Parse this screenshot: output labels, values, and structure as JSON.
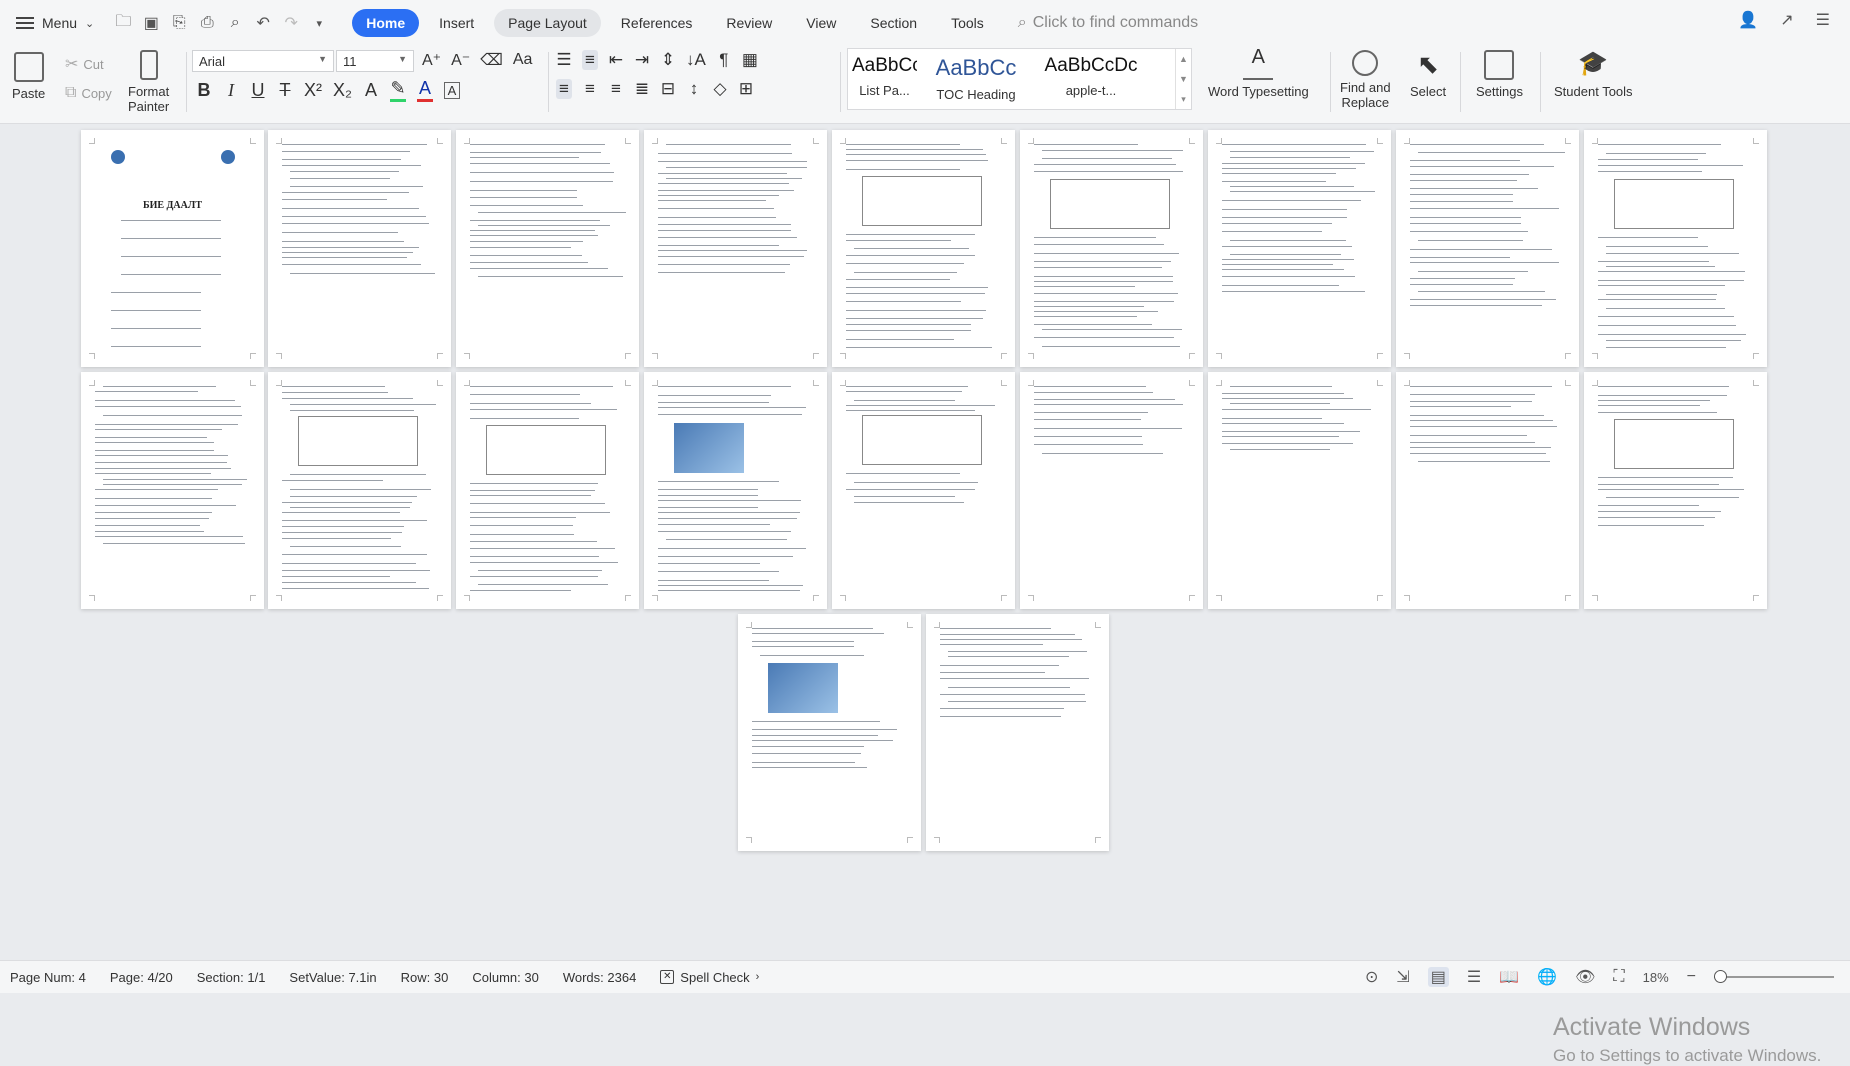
{
  "menubar": {
    "menu_label": "Menu",
    "tabs": [
      "Home",
      "Insert",
      "Page Layout",
      "References",
      "Review",
      "View",
      "Section",
      "Tools"
    ],
    "active_tab": "Home",
    "find_placeholder": "Click to find commands"
  },
  "ribbon": {
    "paste": "Paste",
    "cut": "Cut",
    "copy": "Copy",
    "format_painter_1": "Format",
    "format_painter_2": "Painter",
    "font_name": "Arial",
    "font_size": "11",
    "styles": [
      {
        "sample": "AaBbCcI",
        "name": "List Pa..."
      },
      {
        "sample": "AaBbCc",
        "name": "TOC Heading"
      },
      {
        "sample": "AaBbCcDc",
        "name": "apple-t..."
      }
    ],
    "word_typesetting": "Word Typesetting",
    "find_replace_1": "Find and",
    "find_replace_2": "Replace",
    "select": "Select",
    "settings": "Settings",
    "student_tools": "Student Tools"
  },
  "document": {
    "page1_title": "БИЕ ДААЛТ"
  },
  "watermark": {
    "line1": "Activate Windows",
    "line2": "Go to Settings to activate Windows."
  },
  "status": {
    "page_num": "Page Num: 4",
    "page": "Page: 4/20",
    "section": "Section: 1/1",
    "set_value": "SetValue: 7.1in",
    "row": "Row: 30",
    "column": "Column: 30",
    "words": "Words: 2364",
    "spell_check": "Spell Check",
    "zoom": "18%"
  },
  "colors": {
    "accent": "#2b6ff3",
    "background": "#e9ebee"
  }
}
